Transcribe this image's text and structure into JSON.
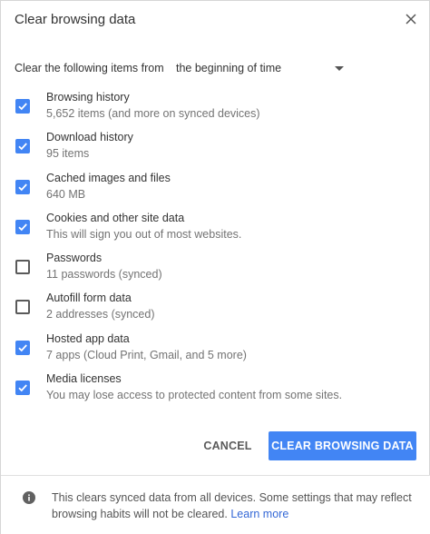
{
  "dialog": {
    "title": "Clear browsing data",
    "close_icon": "close-icon"
  },
  "time_range": {
    "label": "Clear the following items from",
    "selected": "the beginning of time"
  },
  "items": [
    {
      "title": "Browsing history",
      "subtitle": "5,652 items (and more on synced devices)",
      "checked": true
    },
    {
      "title": "Download history",
      "subtitle": "95 items",
      "checked": true
    },
    {
      "title": "Cached images and files",
      "subtitle": "640 MB",
      "checked": true
    },
    {
      "title": "Cookies and other site data",
      "subtitle": "This will sign you out of most websites.",
      "checked": true
    },
    {
      "title": "Passwords",
      "subtitle": "11 passwords (synced)",
      "checked": false
    },
    {
      "title": "Autofill form data",
      "subtitle": "2 addresses (synced)",
      "checked": false
    },
    {
      "title": "Hosted app data",
      "subtitle": "7 apps (Cloud Print, Gmail, and 5 more)",
      "checked": true
    },
    {
      "title": "Media licenses",
      "subtitle": "You may lose access to protected content from some sites.",
      "checked": true
    }
  ],
  "buttons": {
    "cancel": "CANCEL",
    "clear": "CLEAR BROWSING DATA"
  },
  "footer": {
    "text": "This clears synced data from all devices. Some settings that may reflect browsing habits will not be cleared.",
    "link": "Learn more"
  },
  "colors": {
    "accent": "#4285f4",
    "link": "#3367d6"
  }
}
